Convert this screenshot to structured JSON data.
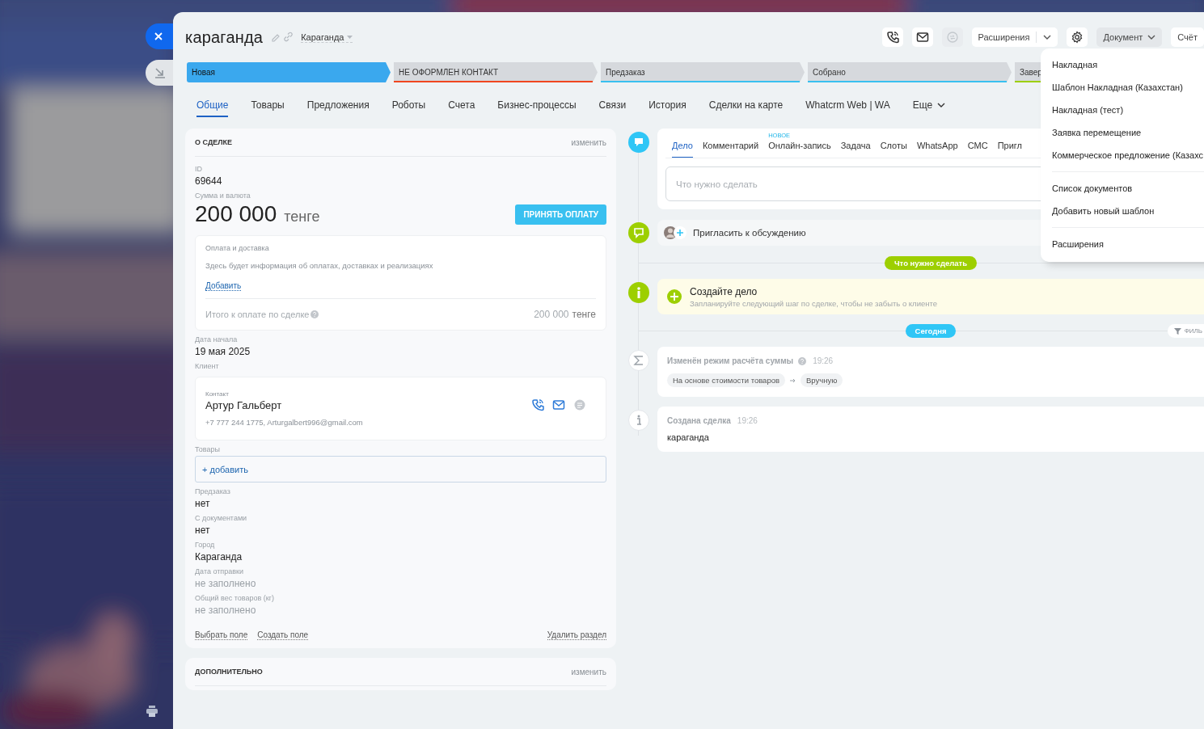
{
  "deal": {
    "title": "караганда",
    "category": "Караганда"
  },
  "toolbar": {
    "icon_buttons": [
      {
        "kind": "phone",
        "disabled": false
      },
      {
        "kind": "mail",
        "disabled": false
      },
      {
        "kind": "chat",
        "disabled": true
      }
    ],
    "extensions": "Расширения",
    "document": "Документ",
    "invoice": "Счёт"
  },
  "stages": [
    {
      "label": "Новая",
      "color": "#3aa8ee",
      "selected": true
    },
    {
      "label": "НЕ ОФОРМЛЕН КОНТАКТ",
      "color": "#f0461f",
      "selected": false
    },
    {
      "label": "Предзаказ",
      "color": "#39c0f0",
      "selected": false
    },
    {
      "label": "Собрано",
      "color": "#39c0f0",
      "selected": false
    },
    {
      "label": "Завер",
      "color": "#9dcf00",
      "selected": false
    }
  ],
  "tabs": [
    {
      "label": "Общие",
      "selected": true
    },
    {
      "label": "Товары",
      "selected": false
    },
    {
      "label": "Предложения",
      "selected": false
    },
    {
      "label": "Роботы",
      "selected": false
    },
    {
      "label": "Счета",
      "selected": false
    },
    {
      "label": "Бизнес-процессы",
      "selected": false
    },
    {
      "label": "Связи",
      "selected": false
    },
    {
      "label": "История",
      "selected": false
    },
    {
      "label": "Сделки на карте",
      "selected": false
    },
    {
      "label": "Whatcrm Web | WA",
      "selected": false
    },
    {
      "label": "Еще",
      "selected": false
    }
  ],
  "about": {
    "title": "О СДЕЛКЕ",
    "edit": "изменить",
    "id_label": "ID",
    "id": "69644",
    "sum_label": "Сумма и валюта",
    "amount": "200 000",
    "currency": "тенге",
    "pay_button": "ПРИНЯТЬ ОПЛАТУ",
    "payment": {
      "title": "Оплата и доставка",
      "hint": "Здесь будет информация об оплатах, доставках и реализациях",
      "add": "Добавить",
      "total_label": "Итого к оплате по сделке",
      "total_amount": "200 000",
      "total_currency": "тенге"
    },
    "fields": [
      {
        "kind": "text",
        "label": "Дата начала",
        "value": "19 мая 2025"
      },
      {
        "kind": "client",
        "label": "Клиент",
        "contact_label": "Контакт",
        "name": "Артур Гальберт",
        "details": "+7 777 244 1775, Arturgalbert996@gmail.com"
      },
      {
        "kind": "products",
        "label": "Товары",
        "add": "+ добавить"
      },
      {
        "kind": "text",
        "label": "Предзаказ",
        "value": "нет"
      },
      {
        "kind": "text",
        "label": "С документами",
        "value": "нет"
      },
      {
        "kind": "text",
        "label": "Город",
        "value": "Караганда"
      },
      {
        "kind": "empty",
        "label": "Дата отправки",
        "value": "не заполнено"
      },
      {
        "kind": "empty",
        "label": "Общий вес товаров (кг)",
        "value": "не заполнено"
      }
    ],
    "actions": {
      "select": "Выбрать поле",
      "create": "Создать поле",
      "delete": "Удалить раздел"
    }
  },
  "extra_section": {
    "title": "ДОПОЛНИТЕЛЬНО",
    "edit": "изменить"
  },
  "timeline": [
    {
      "kind": "editor",
      "tabs": [
        {
          "label": "Дело",
          "selected": true
        },
        {
          "label": "Комментарий",
          "selected": false
        },
        {
          "label": "Онлайн-запись",
          "badge": "НОВОЕ",
          "selected": false
        },
        {
          "label": "Задача",
          "selected": false
        },
        {
          "label": "Слоты",
          "selected": false
        },
        {
          "label": "WhatsApp",
          "selected": false
        },
        {
          "label": "СМС",
          "selected": false
        },
        {
          "label": "Пригл",
          "selected": false
        }
      ],
      "placeholder": "Что нужно сделать"
    },
    {
      "kind": "invite",
      "text": "Пригласить к обсуждению"
    },
    {
      "kind": "divider",
      "label": "Что нужно сделать",
      "color": "#9dcf00"
    },
    {
      "kind": "create_task",
      "title": "Создайте дело",
      "subtitle": "Запланируйте следующий шаг по сделке, чтобы не забыть о клиенте"
    },
    {
      "kind": "divider",
      "label": "Сегодня",
      "color": "#2fc6f6",
      "filter": "ФИЛЬ"
    },
    {
      "kind": "sum_change",
      "title": "Изменён режим расчёта суммы",
      "time": "19:26",
      "from": "На основе стоимости товаров",
      "to": "Вручную"
    },
    {
      "kind": "created",
      "title": "Создана сделка",
      "time": "19:26",
      "text": "караганда"
    }
  ],
  "document_menu": {
    "groups": [
      [
        "Накладная",
        "Шаблон Накладная (Казахстан)",
        "Накладная (тест)",
        "Заявка перемещение",
        "Коммерческое предложение (Казахс"
      ],
      [
        "Список документов",
        "Добавить новый шаблон"
      ],
      [
        "Расширения"
      ]
    ]
  }
}
